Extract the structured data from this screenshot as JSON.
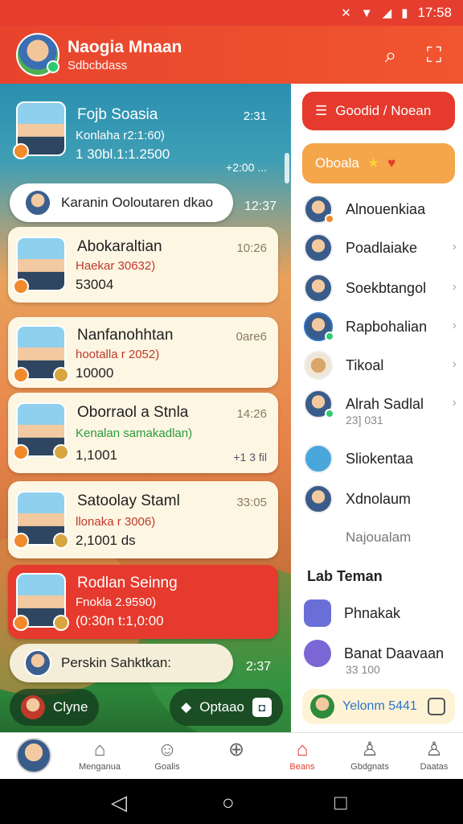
{
  "status": {
    "time": "17:58"
  },
  "header": {
    "title": "Naogia Mnaan",
    "subtitle": "Sdbcbdass"
  },
  "chats": [
    {
      "name": "Fojb Soasia",
      "sub": "Konlaha r2:1:60)",
      "meta": "1 30bl.1:1.2500",
      "time": "2:31",
      "extra": "+2:00 ..."
    },
    {
      "name": "Abokaraltian",
      "sub": "Haekar 30632)",
      "meta": "53004",
      "time": "10:26"
    },
    {
      "name": "Nanfanohhtan",
      "sub": "hootalla r 2052)",
      "meta": "10000",
      "time": "0are6"
    },
    {
      "name": "Oborraol a Stnla",
      "sub": "Kenalan samakadlan)",
      "meta": "1,1001",
      "time": "14:26",
      "extra": "+1 3 fil"
    },
    {
      "name": "Satoolay Staml",
      "sub": "llonaka r 3006)",
      "meta": "2,1001 ds",
      "time": "33:05"
    },
    {
      "name": "Rodlan Seinng",
      "sub": "Fnokla 2.9590)",
      "meta": "(0:30n t:1,0:00"
    }
  ],
  "pills": [
    {
      "text": "Karanin Ooloutaren dkao",
      "time": "12:37"
    },
    {
      "text": "Perskin Sahktkan:",
      "time": "2:37"
    }
  ],
  "bottom_buttons": {
    "left": "Clyne",
    "right": "Optaao"
  },
  "right_panel": {
    "top_button": "Goodid / Noean",
    "orange_button": "Oboala",
    "contacts": [
      {
        "label": "Alnouenkiaa"
      },
      {
        "label": "Poadlaiake"
      },
      {
        "label": "Soekbtangol"
      },
      {
        "label": "Rapbohalian"
      },
      {
        "label": "Tikoal"
      },
      {
        "label": "Alrah Sadlal",
        "sub": "23] 031"
      },
      {
        "label": "Sliokentaa"
      },
      {
        "label": "Xdnolaum"
      }
    ],
    "muted": "Najoualam",
    "section_title": "Lab Teman",
    "section_items": [
      {
        "label": "Phnakak"
      },
      {
        "label": "Banat Daavaan",
        "sub": "33 100"
      }
    ],
    "footer": "Yelonm 5441"
  },
  "tabs": [
    {
      "label": "Menganua"
    },
    {
      "label": "Goalis"
    },
    {
      "label": ""
    },
    {
      "label": "Beans"
    },
    {
      "label": "Gbdgnats"
    },
    {
      "label": "Daatas"
    }
  ],
  "colors": {
    "primary": "#e53a2d",
    "accent_orange": "#f5a54a",
    "teal": "#2a8fb0"
  }
}
